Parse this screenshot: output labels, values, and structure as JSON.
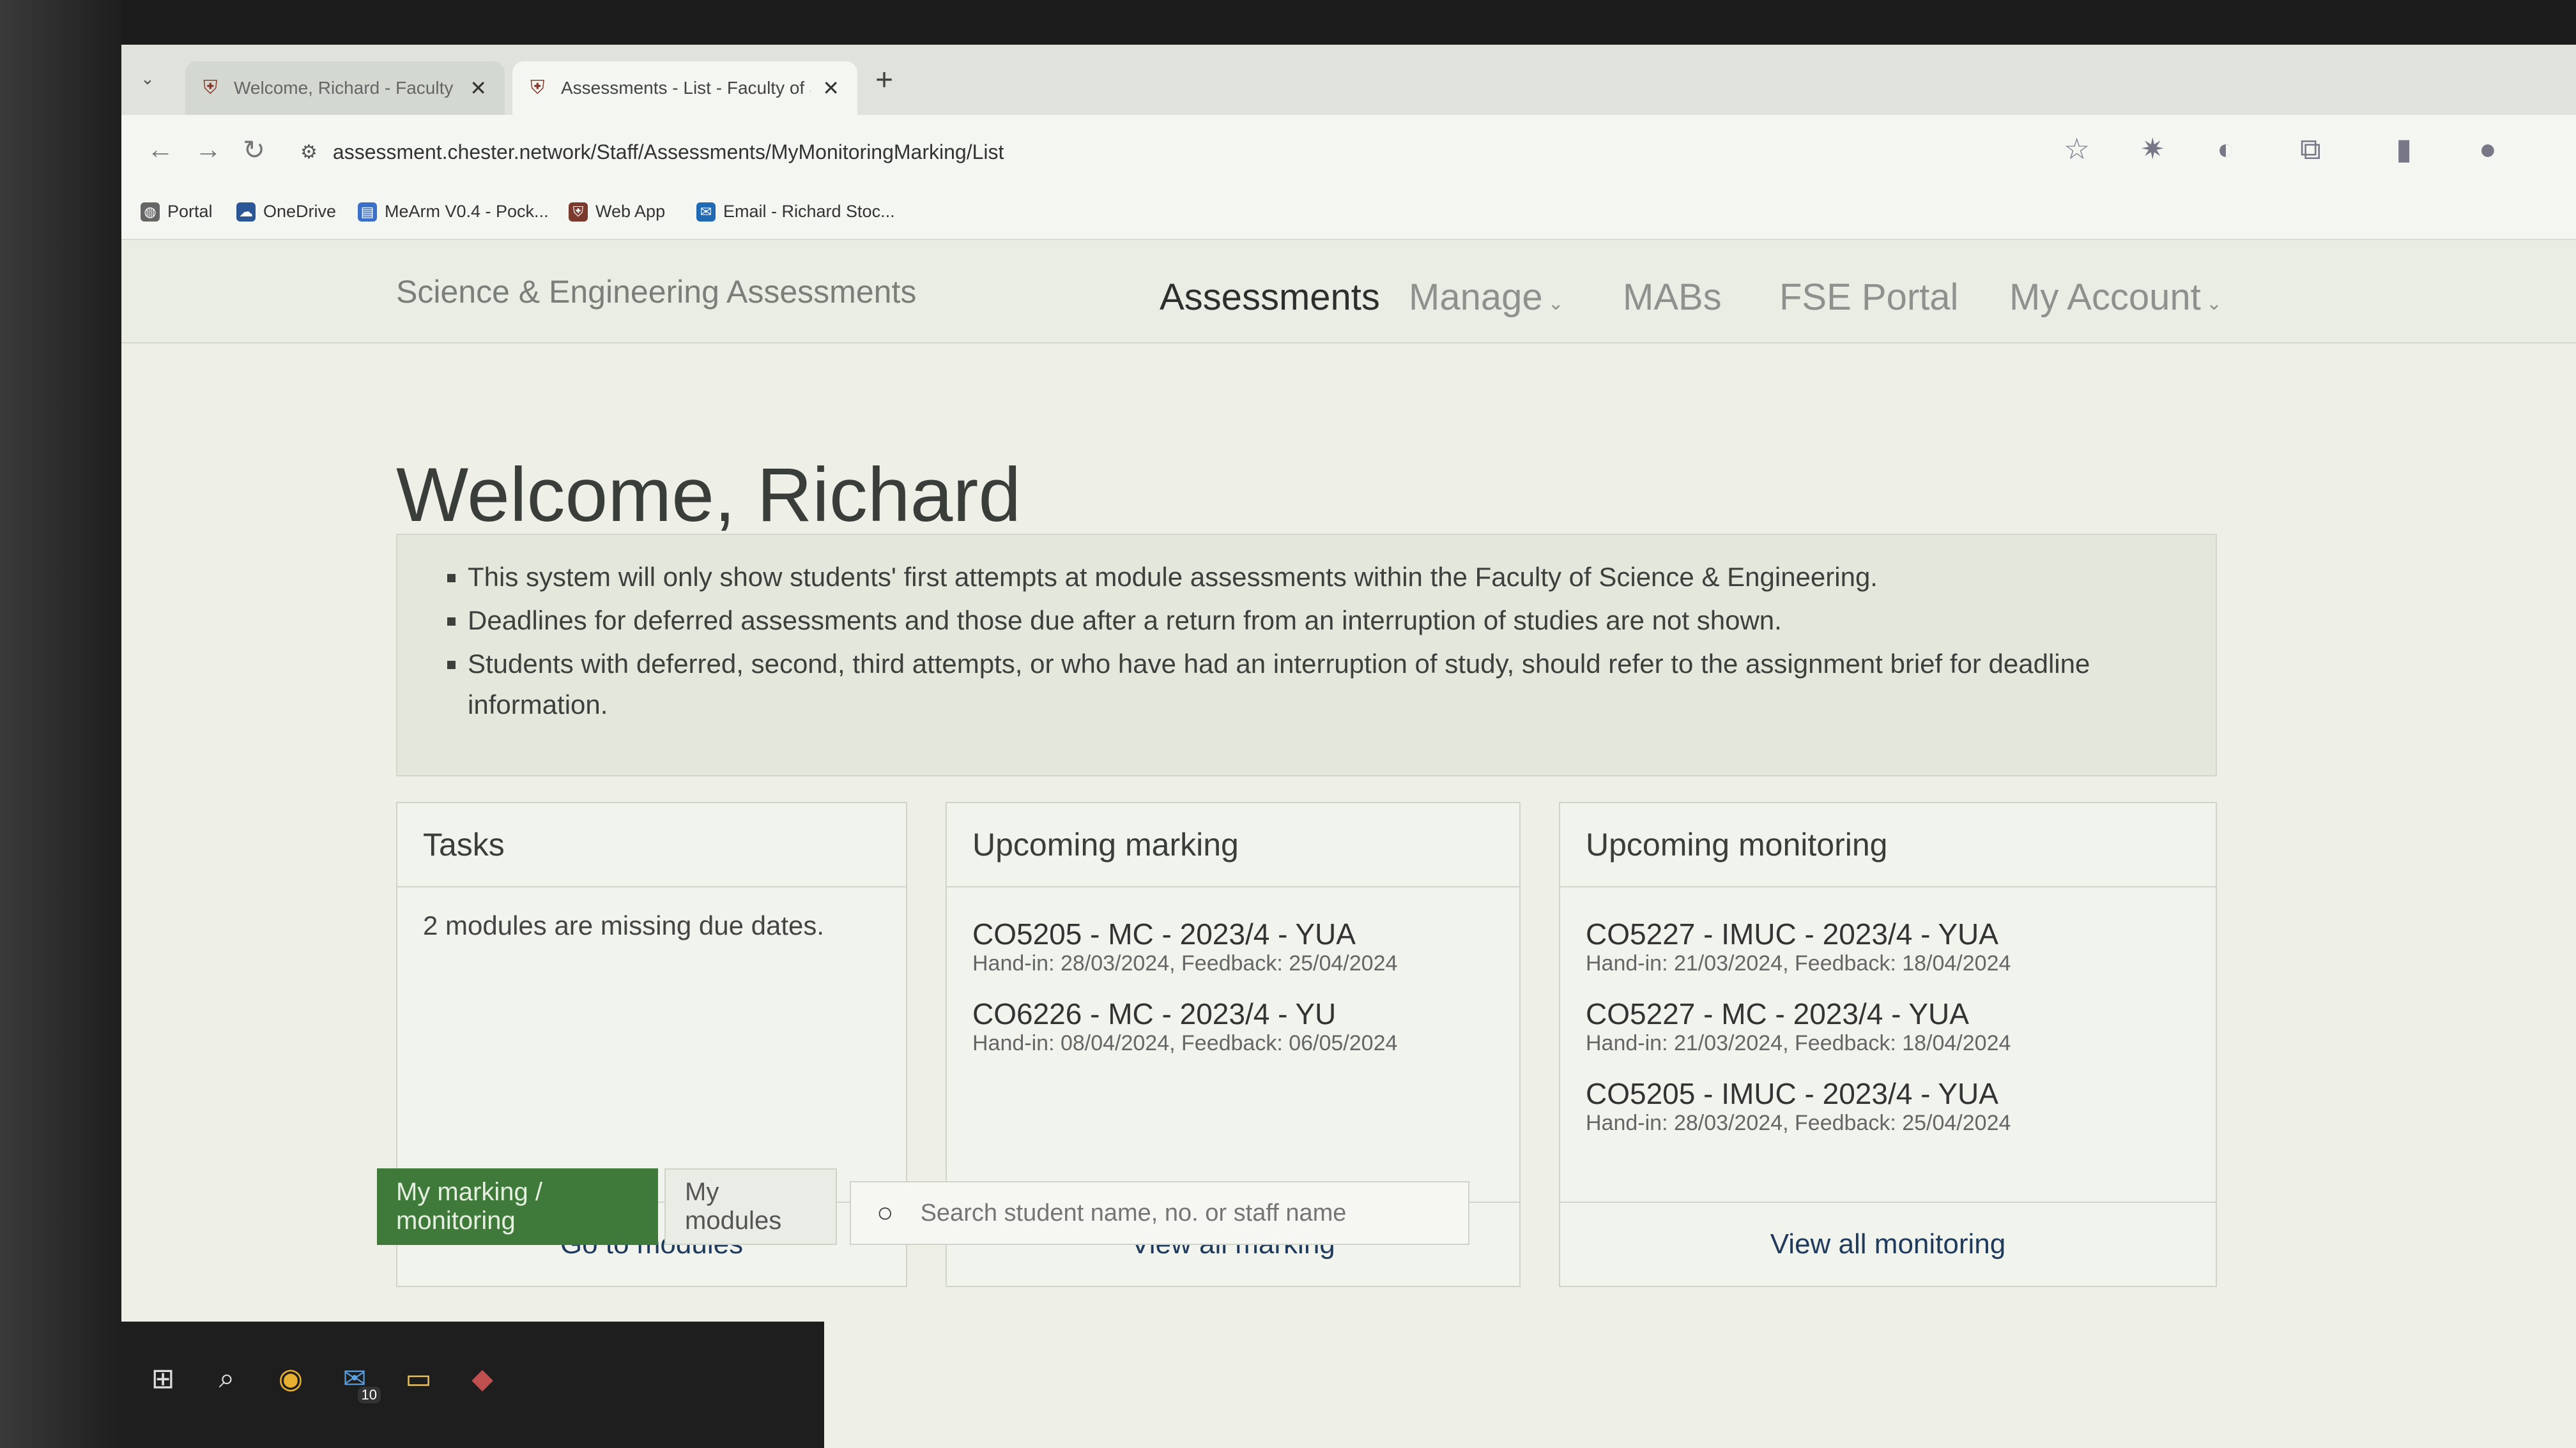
{
  "browser": {
    "tabs": [
      {
        "title": "Welcome, Richard - Faculty of S",
        "active": false
      },
      {
        "title": "Assessments - List - Faculty of S",
        "active": true
      }
    ],
    "new_tab": "+",
    "url": "assessment.chester.network/Staff/Assessments/MyMonitoringMarking/List",
    "bookmarks": [
      {
        "label": "Portal",
        "icon": "globe-icon"
      },
      {
        "label": "OneDrive",
        "icon": "cloud-icon"
      },
      {
        "label": "MeArm V0.4 - Pock...",
        "icon": "doc-icon"
      },
      {
        "label": "Web App",
        "icon": "crest-icon"
      },
      {
        "label": "Email - Richard Stoc...",
        "icon": "outlook-icon"
      }
    ]
  },
  "nav": {
    "brand": "Science & Engineering Assessments",
    "links": [
      {
        "label": "Assessments",
        "active": true,
        "dropdown": false
      },
      {
        "label": "Manage",
        "active": false,
        "dropdown": true
      },
      {
        "label": "MABs",
        "active": false,
        "dropdown": false
      },
      {
        "label": "FSE Portal",
        "active": false,
        "dropdown": false
      },
      {
        "label": "My Account",
        "active": false,
        "dropdown": true
      }
    ]
  },
  "welcome": "Welcome, Richard",
  "info": [
    "This system will only show students' first attempts at module assessments within the Faculty of Science & Engineering.",
    "Deadlines for deferred assessments and those due after a return from an interruption of studies are not shown.",
    "Students with deferred, second, third attempts, or who have had an interruption of study, should refer to the assignment brief for deadline information."
  ],
  "tasks": {
    "title": "Tasks",
    "text": "2 modules are missing due dates.",
    "footer": "Go to modules"
  },
  "marking": {
    "title": "Upcoming marking",
    "items": [
      {
        "title": "CO5205 - MC - 2023/4 - YUA",
        "sub": "Hand-in: 28/03/2024, Feedback: 25/04/2024"
      },
      {
        "title": "CO6226 - MC - 2023/4 - YU",
        "sub": "Hand-in: 08/04/2024, Feedback: 06/05/2024"
      }
    ],
    "footer": "View all marking"
  },
  "monitoring": {
    "title": "Upcoming monitoring",
    "items": [
      {
        "title": "CO5227 - IMUC - 2023/4 - YUA",
        "sub": "Hand-in: 21/03/2024, Feedback: 18/04/2024"
      },
      {
        "title": "CO5227 - MC - 2023/4 - YUA",
        "sub": "Hand-in: 21/03/2024, Feedback: 18/04/2024"
      },
      {
        "title": "CO5205 - IMUC - 2023/4 - YUA",
        "sub": "Hand-in: 28/03/2024, Feedback: 25/04/2024"
      }
    ],
    "footer": "View all monitoring"
  },
  "page_tabs": [
    "My marking / monitoring",
    "My modules"
  ],
  "search": {
    "placeholder": "Search student name, no. or staff name"
  },
  "taskbar": {
    "mail_badge": "10"
  },
  "colors": {
    "accent_green": "#3f7a3a",
    "link_blue": "#1f3a5a"
  }
}
